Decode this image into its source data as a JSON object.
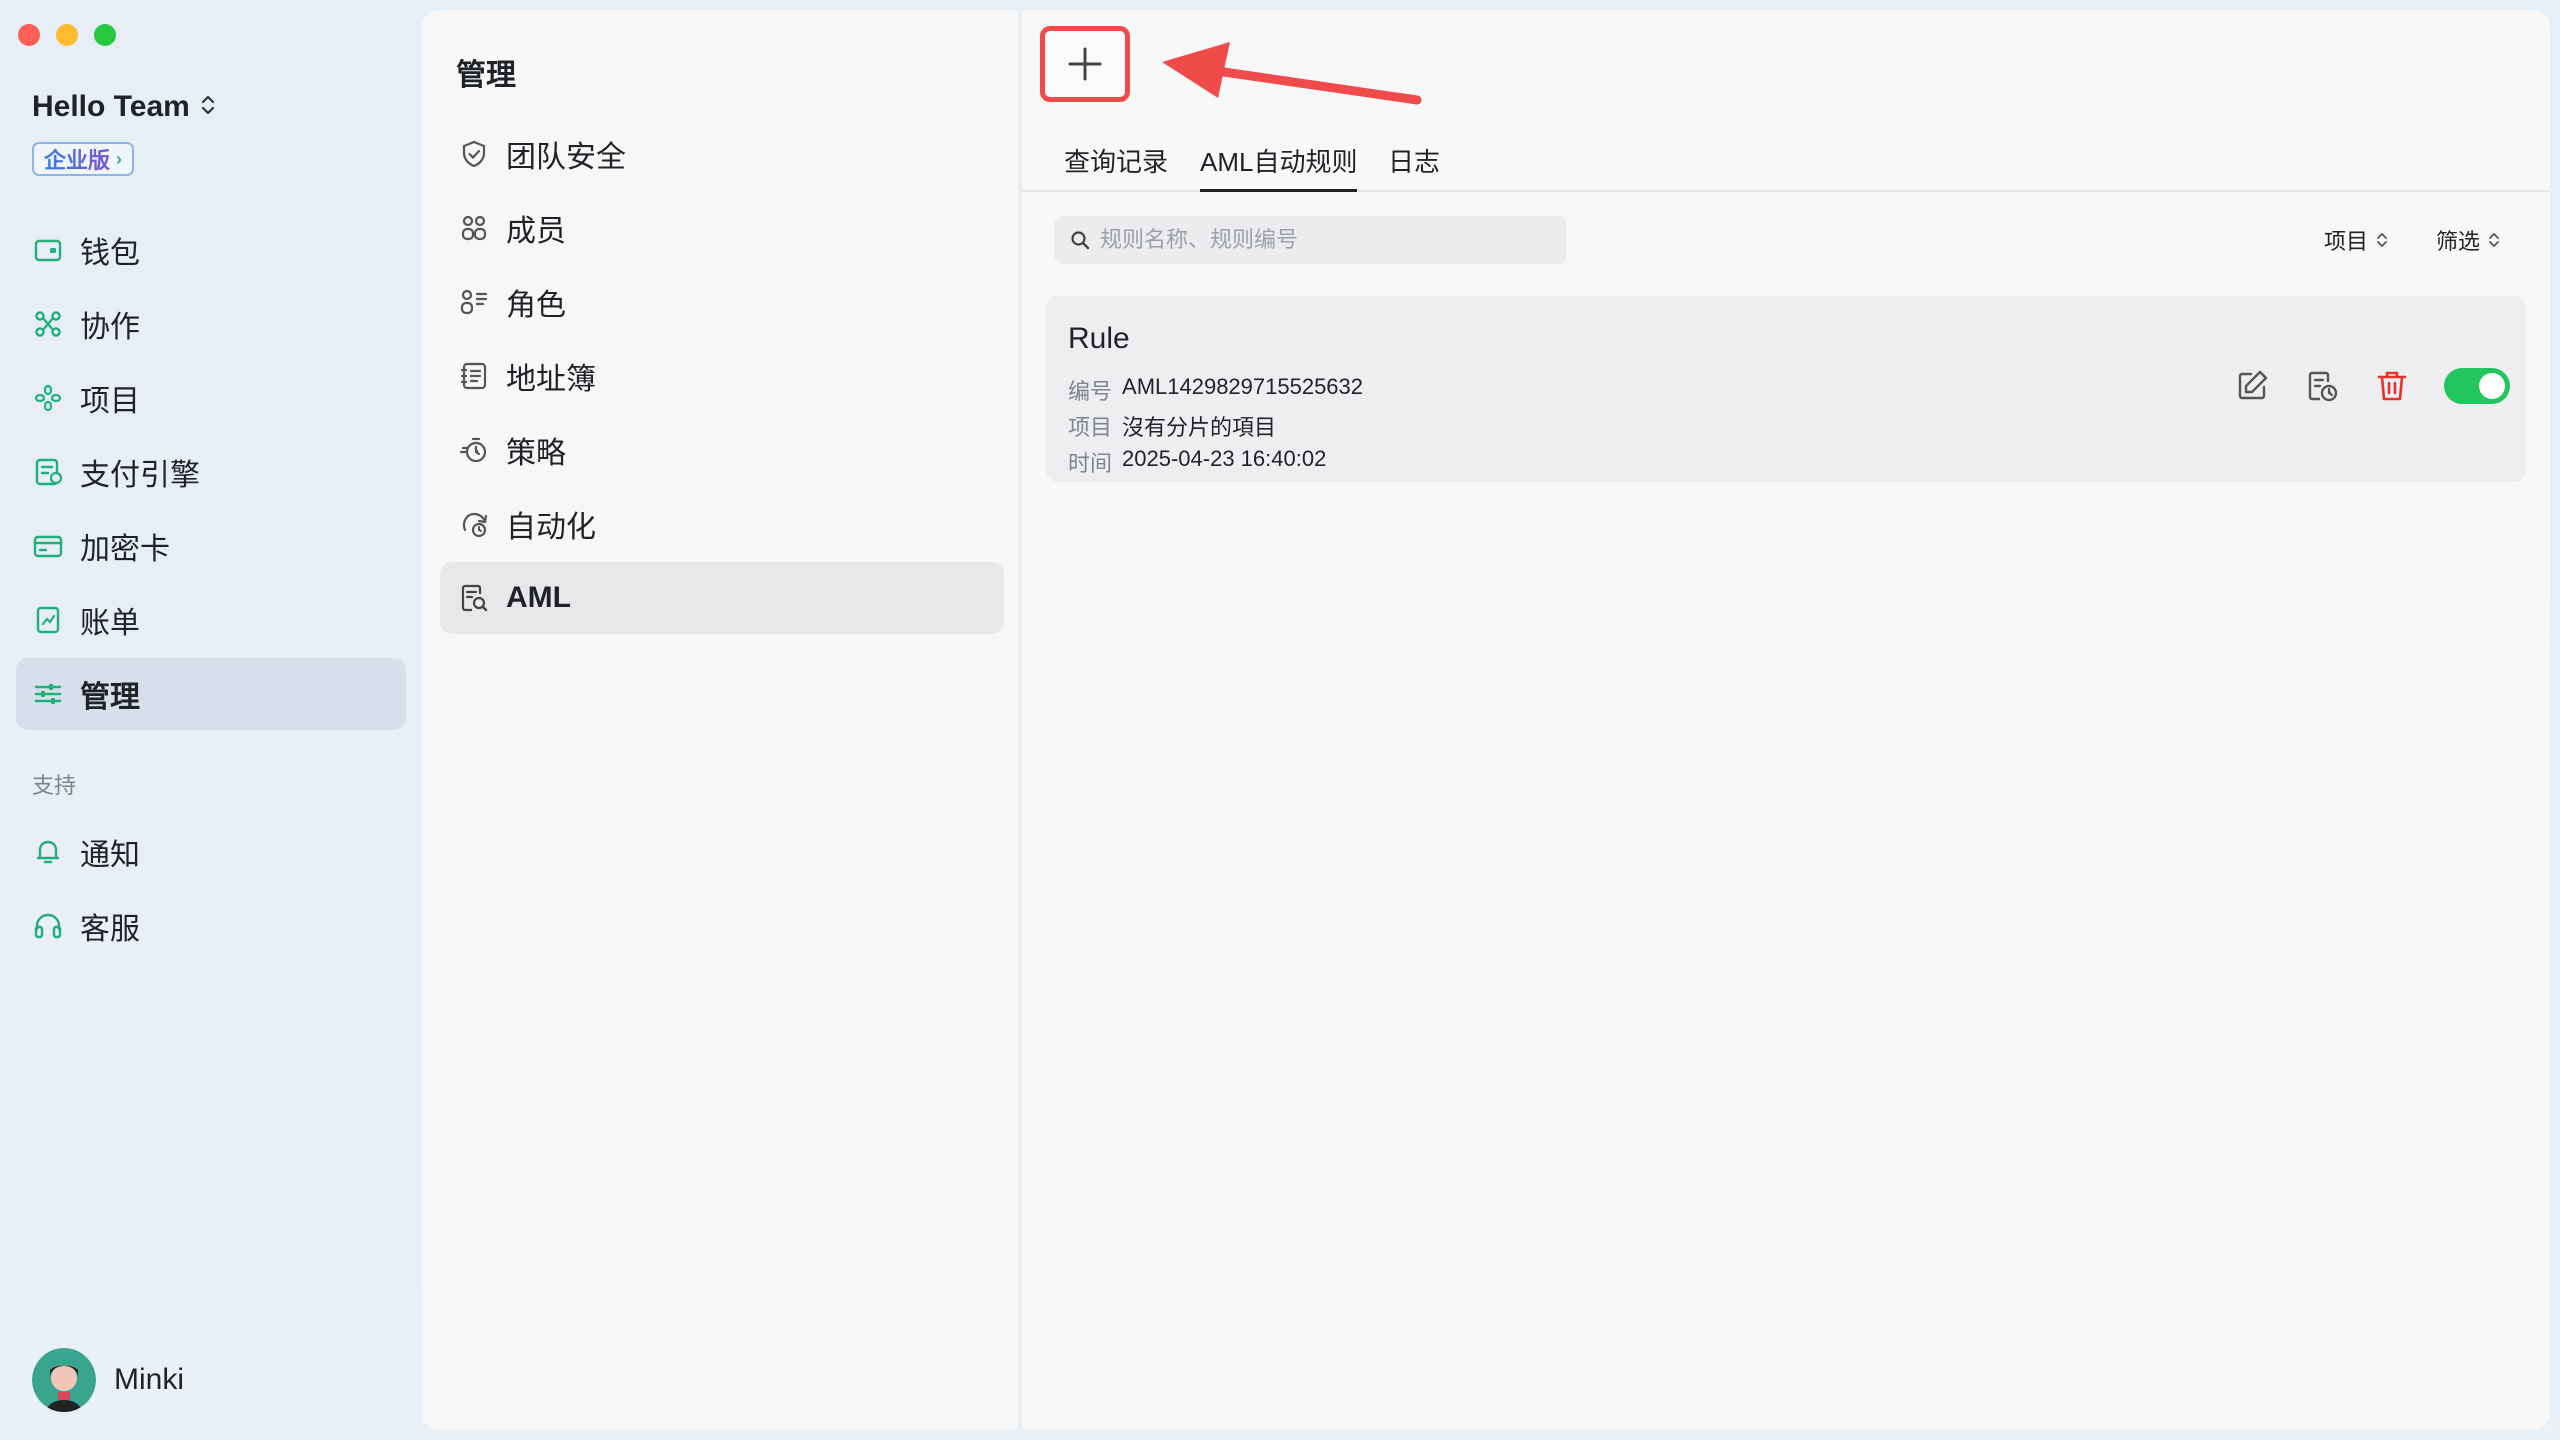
{
  "sidebar": {
    "team_name": "Hello Team",
    "badge": "企业版",
    "items": [
      {
        "label": "钱包",
        "icon": "wallet-icon"
      },
      {
        "label": "协作",
        "icon": "collab-icon"
      },
      {
        "label": "项目",
        "icon": "project-icon"
      },
      {
        "label": "支付引擎",
        "icon": "payment-engine-icon"
      },
      {
        "label": "加密卡",
        "icon": "crypto-card-icon"
      },
      {
        "label": "账单",
        "icon": "bill-icon"
      },
      {
        "label": "管理",
        "icon": "manage-icon",
        "active": true
      }
    ],
    "support_label": "支持",
    "support_items": [
      {
        "label": "通知",
        "icon": "bell-icon"
      },
      {
        "label": "客服",
        "icon": "headset-icon"
      }
    ],
    "user_name": "Minki"
  },
  "middle": {
    "title": "管理",
    "items": [
      {
        "label": "团队安全",
        "icon": "shield-icon"
      },
      {
        "label": "成员",
        "icon": "members-icon"
      },
      {
        "label": "角色",
        "icon": "roles-icon"
      },
      {
        "label": "地址簿",
        "icon": "address-book-icon"
      },
      {
        "label": "策略",
        "icon": "policy-icon"
      },
      {
        "label": "自动化",
        "icon": "automation-icon"
      },
      {
        "label": "AML",
        "icon": "aml-icon",
        "active": true
      }
    ]
  },
  "main": {
    "tabs": [
      {
        "label": "查询记录"
      },
      {
        "label": "AML自动规则",
        "active": true
      },
      {
        "label": "日志"
      }
    ],
    "search_placeholder": "规则名称、规则编号",
    "filters": {
      "project": "项目",
      "filter": "筛选"
    },
    "rule": {
      "title": "Rule",
      "id_key": "编号",
      "id_value": "AML1429829715525632",
      "project_key": "项目",
      "project_value": "沒有分片的項目",
      "time_key": "时间",
      "time_value": "2025-04-23 16:40:02",
      "enabled": true
    }
  },
  "colors": {
    "accent_green": "#22c55e",
    "icon_green": "#22b07a",
    "highlight_red": "#ef4b4b",
    "delete_red": "#e5322d"
  }
}
